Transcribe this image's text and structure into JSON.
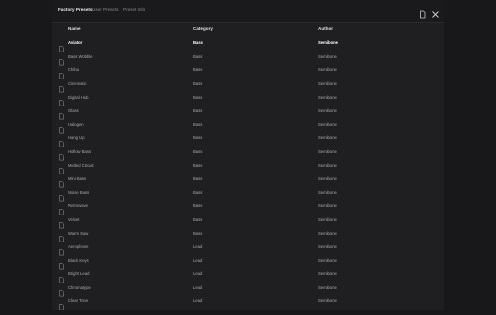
{
  "tabs": [
    {
      "label": "Factory Presets",
      "active": true
    },
    {
      "label": "User Presets",
      "active": false
    },
    {
      "label": "Preset Info",
      "active": false
    }
  ],
  "icons": {
    "document": "document-icon",
    "close": "close-icon"
  },
  "columns": {
    "name": "Name",
    "category": "Category",
    "author": "Author"
  },
  "rows": [
    {
      "name": "Aviator",
      "category": "Bass",
      "author": "Semibone",
      "selected": true
    },
    {
      "name": "Bass Wobble",
      "category": "Bass",
      "author": "Semibone"
    },
    {
      "name": "Chiba",
      "category": "Bass",
      "author": "Semibone"
    },
    {
      "name": "Cinematic",
      "category": "Bass",
      "author": "Semibone"
    },
    {
      "name": "Digital Hub",
      "category": "Bass",
      "author": "Semibone"
    },
    {
      "name": "Glass",
      "category": "Bass",
      "author": "Semibone"
    },
    {
      "name": "Halogen",
      "category": "Bass",
      "author": "Semibone"
    },
    {
      "name": "Hang Up",
      "category": "Bass",
      "author": "Semibone"
    },
    {
      "name": "Hollow Bass",
      "category": "Bass",
      "author": "Semibone"
    },
    {
      "name": "Melted Circuit",
      "category": "Bass",
      "author": "Semibone"
    },
    {
      "name": "Mini Bass",
      "category": "Bass",
      "author": "Semibone"
    },
    {
      "name": "Noise Bass",
      "category": "Bass",
      "author": "Semibone"
    },
    {
      "name": "Retrowave",
      "category": "Bass",
      "author": "Semibone"
    },
    {
      "name": "Velvet",
      "category": "Bass",
      "author": "Semibone"
    },
    {
      "name": "Warm Saw",
      "category": "Bass",
      "author": "Semibone"
    },
    {
      "name": "Aerophone",
      "category": "Lead",
      "author": "Semibone"
    },
    {
      "name": "Black Keys",
      "category": "Lead",
      "author": "Semibone"
    },
    {
      "name": "Bright Lead",
      "category": "Lead",
      "author": "Semibone"
    },
    {
      "name": "Chromatype",
      "category": "Lead",
      "author": "Semibone"
    },
    {
      "name": "Clear Tone",
      "category": "Lead",
      "author": "Semibone"
    }
  ]
}
